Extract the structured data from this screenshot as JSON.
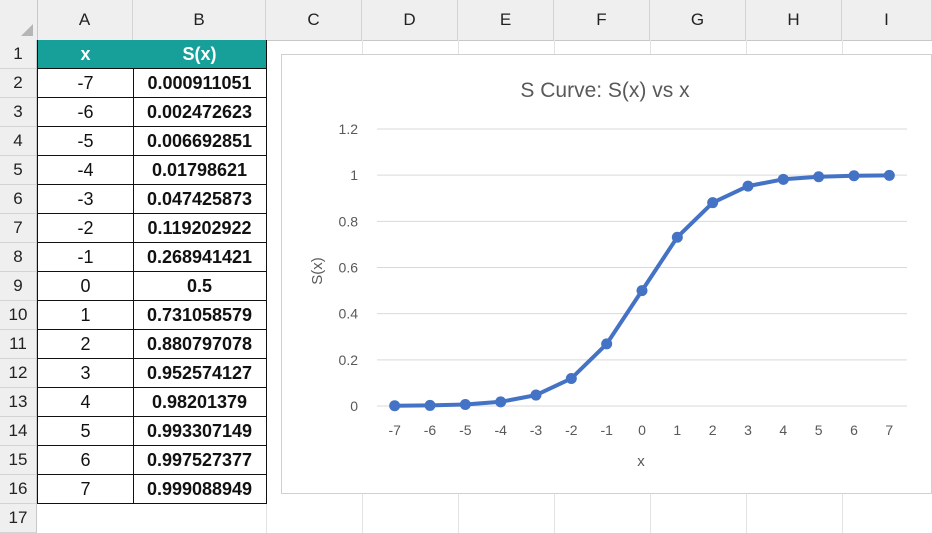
{
  "spreadsheet": {
    "columns": [
      "A",
      "B",
      "C",
      "D",
      "E",
      "F",
      "G",
      "H",
      "I"
    ],
    "rows": [
      "1",
      "2",
      "3",
      "4",
      "5",
      "6",
      "7",
      "8",
      "9",
      "10",
      "11",
      "12",
      "13",
      "14",
      "15",
      "16",
      "17"
    ],
    "header_x": "x",
    "header_sx": "S(x)",
    "table": [
      {
        "x": "-7",
        "sx": "0.000911051"
      },
      {
        "x": "-6",
        "sx": "0.002472623"
      },
      {
        "x": "-5",
        "sx": "0.006692851"
      },
      {
        "x": "-4",
        "sx": "0.01798621"
      },
      {
        "x": "-3",
        "sx": "0.047425873"
      },
      {
        "x": "-2",
        "sx": "0.119202922"
      },
      {
        "x": "-1",
        "sx": "0.268941421"
      },
      {
        "x": "0",
        "sx": "0.5"
      },
      {
        "x": "1",
        "sx": "0.731058579"
      },
      {
        "x": "2",
        "sx": "0.880797078"
      },
      {
        "x": "3",
        "sx": "0.952574127"
      },
      {
        "x": "4",
        "sx": "0.98201379"
      },
      {
        "x": "5",
        "sx": "0.993307149"
      },
      {
        "x": "6",
        "sx": "0.997527377"
      },
      {
        "x": "7",
        "sx": "0.999088949"
      }
    ],
    "header_fill": "#17a09a"
  },
  "chart_data": {
    "type": "line",
    "title": "S Curve: S(x) vs x",
    "xlabel": "x",
    "ylabel": "S(x)",
    "x": [
      -7,
      -6,
      -5,
      -4,
      -3,
      -2,
      -1,
      0,
      1,
      2,
      3,
      4,
      5,
      6,
      7
    ],
    "series": [
      {
        "values": [
          0.000911051,
          0.002472623,
          0.006692851,
          0.01798621,
          0.047425873,
          0.119202922,
          0.268941421,
          0.5,
          0.731058579,
          0.880797078,
          0.952574127,
          0.98201379,
          0.993307149,
          0.997527377,
          0.999088949
        ]
      }
    ],
    "ylim": [
      0,
      1.2
    ],
    "yticks": [
      "0",
      "0.2",
      "0.4",
      "0.6",
      "0.8",
      "1",
      "1.2"
    ],
    "xticks": [
      "-7",
      "-6",
      "-5",
      "-4",
      "-3",
      "-2",
      "-1",
      "0",
      "1",
      "2",
      "3",
      "4",
      "5",
      "6",
      "7"
    ],
    "grid": "horizontal",
    "markers": true,
    "line_color": "#4472c4"
  }
}
